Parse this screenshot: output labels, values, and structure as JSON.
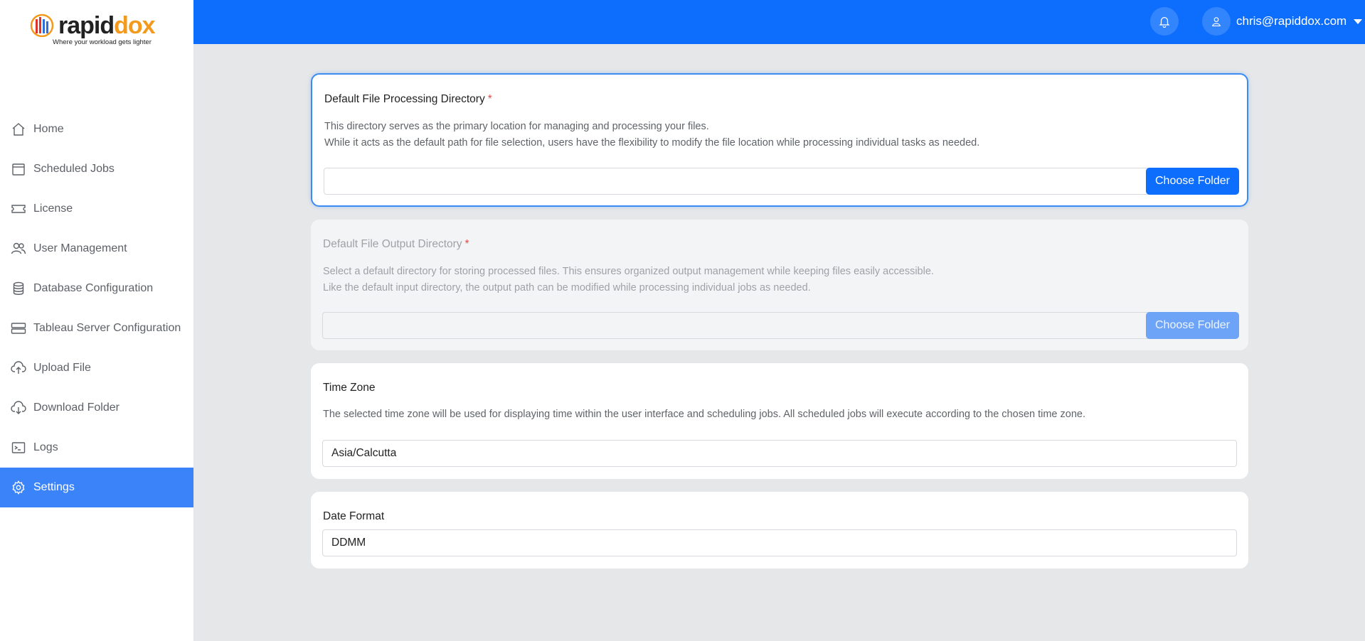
{
  "brand": {
    "name_part1": "rapid",
    "name_part2": "dox",
    "tagline": "Where your workload gets lighter"
  },
  "sidebar": {
    "items": [
      {
        "label": "Home",
        "icon": "home-icon"
      },
      {
        "label": "Scheduled Jobs",
        "icon": "calendar-icon"
      },
      {
        "label": "License",
        "icon": "ticket-icon"
      },
      {
        "label": "User Management",
        "icon": "users-icon"
      },
      {
        "label": "Database Configuration",
        "icon": "database-icon"
      },
      {
        "label": "Tableau Server Configuration",
        "icon": "server-icon"
      },
      {
        "label": "Upload File",
        "icon": "cloud-upload-icon"
      },
      {
        "label": "Download Folder",
        "icon": "cloud-download-icon"
      },
      {
        "label": "Logs",
        "icon": "terminal-icon"
      },
      {
        "label": "Settings",
        "icon": "gear-icon",
        "active": true
      }
    ]
  },
  "header": {
    "user_email": "chris@rapiddox.com"
  },
  "settings": {
    "processing": {
      "title": "Default File Processing Directory",
      "required_mark": "*",
      "desc_line1": "This directory serves as the primary location for managing and processing your files.",
      "desc_line2": "While it acts as the default path for file selection, users have the flexibility to modify the file location while processing individual tasks as needed.",
      "value": "",
      "button_label": "Choose Folder"
    },
    "output": {
      "title": "Default File Output Directory",
      "required_mark": "*",
      "desc_line1": "Select a default directory for storing processed files. This ensures organized output management while keeping files easily accessible.",
      "desc_line2": "Like the default input directory, the output path can be modified while processing individual jobs as needed.",
      "value": "",
      "button_label": "Choose Folder"
    },
    "timezone": {
      "title": "Time Zone",
      "desc": "The selected time zone will be used for displaying time within the user interface and scheduling jobs. All scheduled jobs will execute according to the chosen time zone.",
      "value": "Asia/Calcutta"
    },
    "date_format": {
      "title": "Date Format",
      "value": "DDMM"
    }
  },
  "colors": {
    "primary": "#0d6efd",
    "active_nav": "#3a83f8",
    "accent_orange": "#f39a1d"
  }
}
